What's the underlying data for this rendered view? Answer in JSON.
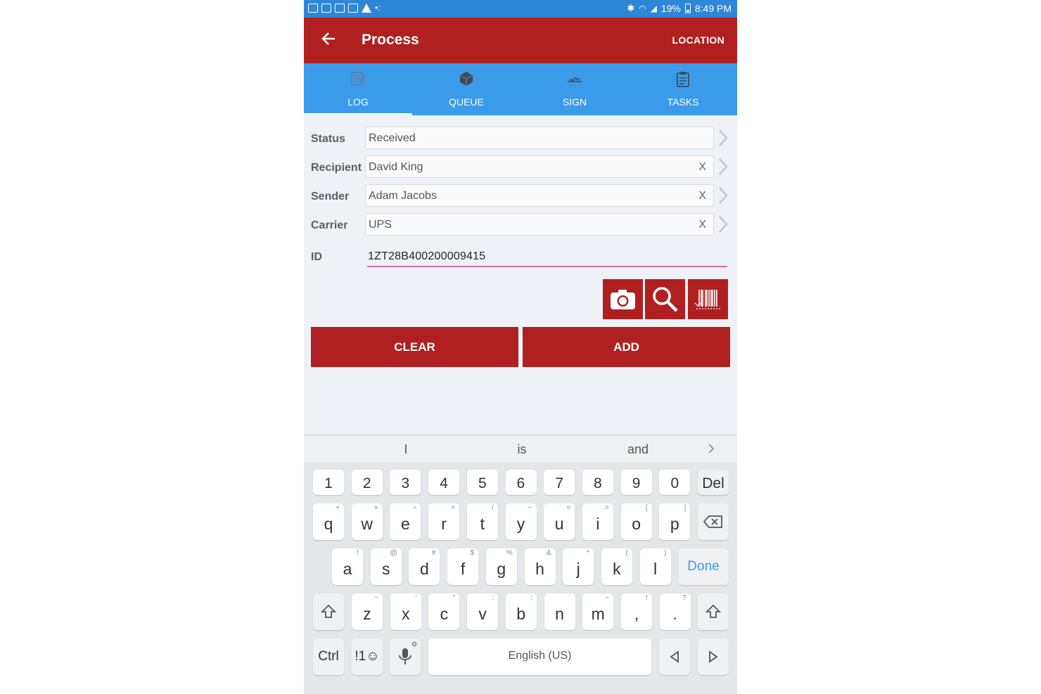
{
  "status_bar": {
    "battery": "19%",
    "time": "8:49 PM"
  },
  "appbar": {
    "title": "Process",
    "action": "LOCATION"
  },
  "tabs": [
    {
      "label": "LOG",
      "icon": "log-icon"
    },
    {
      "label": "QUEUE",
      "icon": "box-icon"
    },
    {
      "label": "SIGN",
      "icon": "signature-icon"
    },
    {
      "label": "TASKS",
      "icon": "clipboard-icon"
    }
  ],
  "form": {
    "status": {
      "label": "Status",
      "value": "Received"
    },
    "recipient": {
      "label": "Recipient",
      "value": "David King",
      "clear": "X"
    },
    "sender": {
      "label": "Sender",
      "value": "Adam Jacobs",
      "clear": "X"
    },
    "carrier": {
      "label": "Carrier",
      "value": "UPS",
      "clear": "X"
    },
    "id": {
      "label": "ID",
      "value": "1ZT28B400200009415"
    }
  },
  "buttons": {
    "clear": "CLEAR",
    "add": "ADD"
  },
  "keyboard": {
    "suggestions": [
      "I",
      "is",
      "and"
    ],
    "numbers": [
      "1",
      "2",
      "3",
      "4",
      "5",
      "6",
      "7",
      "8",
      "9",
      "0"
    ],
    "del": "Del",
    "row1": [
      "q",
      "w",
      "e",
      "r",
      "t",
      "y",
      "u",
      "i",
      "o",
      "p"
    ],
    "row1_sub": [
      "+",
      "×",
      "÷",
      "=",
      "/",
      "−",
      "<",
      ">",
      "[",
      "]"
    ],
    "row2": [
      "a",
      "s",
      "d",
      "f",
      "g",
      "h",
      "j",
      "k",
      "l"
    ],
    "row2_sub": [
      "!",
      "@",
      "#",
      "$",
      "%",
      "&",
      "*",
      "(",
      ")"
    ],
    "done": "Done",
    "row3": [
      "z",
      "x",
      "c",
      "v",
      "b",
      "n",
      "m",
      ",",
      "."
    ],
    "row3_sub": [
      "−",
      "'",
      "\"",
      ":",
      ";",
      "`",
      "~",
      "!",
      "?"
    ],
    "ctrl": "Ctrl",
    "symbols": "!1☺",
    "space": "English (US)"
  },
  "colors": {
    "brand_red": "#b02020",
    "tab_blue": "#3a9bea",
    "status_blue": "#2d87d6",
    "id_underline": "#d96b9b"
  }
}
